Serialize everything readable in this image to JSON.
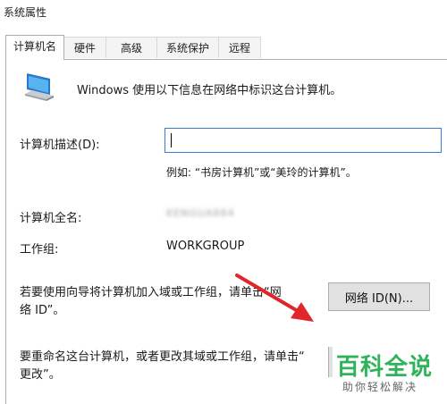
{
  "window": {
    "title": "系统属性"
  },
  "tabs": [
    {
      "label": "计算机名",
      "active": true
    },
    {
      "label": "硬件",
      "active": false
    },
    {
      "label": "高级",
      "active": false
    },
    {
      "label": "系统保护",
      "active": false
    },
    {
      "label": "远程",
      "active": false
    }
  ],
  "content": {
    "intro": "Windows 使用以下信息在网络中标识这台计算机。",
    "description_label": "计算机描述(D):",
    "description_value": "",
    "example_text": "例如: “书房计算机”或“美玲的计算机”。",
    "fullname_label": "计算机全名:",
    "fullname_value": "KENGUA884",
    "workgroup_label": "工作组:",
    "workgroup_value": "WORKGROUP",
    "join_line1": "若要使用向导将计算机加入域或工作组，请单击“网",
    "join_line2": "络 ID”。",
    "network_id_button": "网络 ID(N)...",
    "rename_line1": "要重命名这台计算机，或者更改其域或工作组，请单击“",
    "rename_line2": "更改”。"
  },
  "watermark": {
    "title": "百科全说",
    "subtitle": "助你轻松解决"
  },
  "colors": {
    "accent": "#3a7bd5",
    "arrow": "#e0262b",
    "watermark": "#2fb35a"
  }
}
